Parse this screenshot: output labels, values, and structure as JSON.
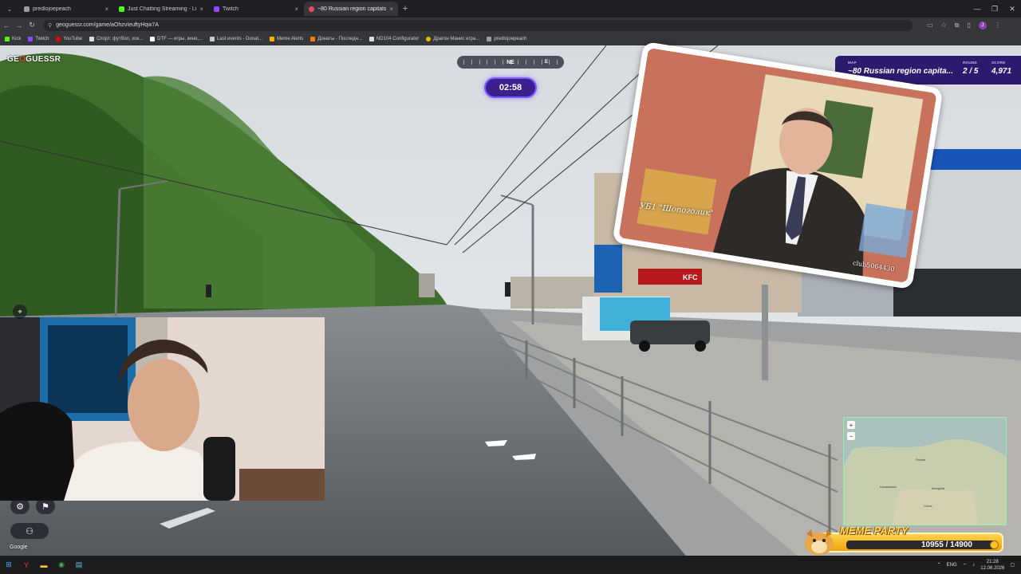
{
  "browser": {
    "tabs": [
      {
        "label": "predlojoepeach",
        "color": "#9b9ba0",
        "active": false
      },
      {
        "label": "Just Chatting Streaming - Live",
        "color": "#53fc18",
        "active": false
      },
      {
        "label": "Twitch",
        "color": "#9146ff",
        "active": false
      },
      {
        "label": "~80 Russian region capitals",
        "color": "#e84a5f",
        "active": true
      }
    ],
    "url": "geoguessr.com/game/aOhzvIeuftyHqw7A",
    "bookmarks": [
      {
        "label": "Kick",
        "color": "#53fc18"
      },
      {
        "label": "Twitch",
        "color": "#9146ff"
      },
      {
        "label": "YouTube",
        "color": "#ff0000"
      },
      {
        "label": "Спорт: футбол, хок...",
        "color": "#dddddd"
      },
      {
        "label": "DTF — игры, кино,...",
        "color": "#ffffff"
      },
      {
        "label": "Last events - Donat...",
        "color": "#f57d07"
      },
      {
        "label": "Meme Alerts",
        "color": "#ffb400"
      },
      {
        "label": "Донаты - Последн...",
        "color": "#f57d07"
      },
      {
        "label": "ND104 Configurator",
        "color": "#dddddd"
      },
      {
        "label": "Драгон Манис игра...",
        "color": "#e6b800"
      },
      {
        "label": "predlojoepeach",
        "color": "#9b9ba0"
      }
    ],
    "avatar_letter": "J"
  },
  "game": {
    "logo_pre": "GE",
    "logo_o": "O",
    "logo_post": "GUESSR",
    "compass_heading": "NE",
    "compass_e": "E",
    "timer": "02:58",
    "map_label": "MAP",
    "map_value": "~80 Russian region capita...",
    "round_label": "ROUND",
    "round_value": "2 / 5",
    "score_label": "SCORE",
    "score_value": "4,971",
    "google_watermark": "Google"
  },
  "overlay": {
    "caption": "УБ1 \"Шопоголик\"",
    "watermark": "club5064430"
  },
  "minimap": {
    "zoom_in": "+",
    "zoom_out": "−",
    "labels": [
      "Russia",
      "Kazakhstan",
      "Mongolia",
      "China"
    ]
  },
  "meme_party": {
    "title": "MEME PARTY",
    "current": "10955",
    "separator": " / ",
    "goal": "14900"
  },
  "taskbar": {
    "lang": "ENG",
    "time": "21:28",
    "date": "12.08.2026"
  },
  "colors": {
    "accent": "#7c5cff",
    "panel": "#2b1a6e",
    "meme_gold": "#ffd34d"
  }
}
